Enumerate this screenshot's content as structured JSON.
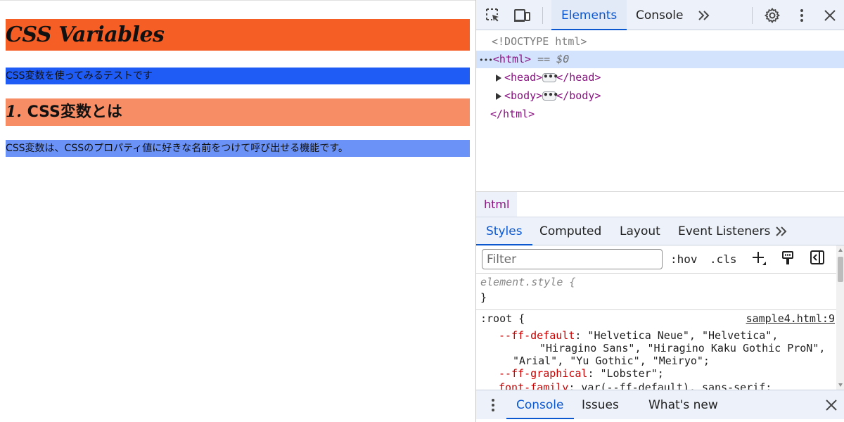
{
  "page": {
    "h1": "CSS Variables",
    "p1": "CSS変数を使ってみるテストです",
    "h2_number": "1.",
    "h2_text": " CSS変数とは",
    "p2": "CSS変数は、CSSのプロパティ値に好きな名前をつけて呼び出せる機能です。"
  },
  "devtools": {
    "tabs": [
      "Elements",
      "Console"
    ],
    "active_tab": "Elements",
    "more_tabs": "»",
    "dom": {
      "doctype": "<!DOCTYPE html>",
      "html_open": "<html>",
      "selected_marker": "== $0",
      "selected_prefix": "•••",
      "head_open": "<head>",
      "head_close": "</head>",
      "body_open": "<body>",
      "body_close": "</body>",
      "html_close": "</html>",
      "ellipsis": "•••"
    },
    "breadcrumb": "html",
    "sub_tabs": [
      "Styles",
      "Computed",
      "Layout",
      "Event Listeners"
    ],
    "active_sub_tab": "Styles",
    "sub_more": "»",
    "filter": {
      "placeholder": "Filter",
      "value": ""
    },
    "filter_buttons": {
      "hov": ":hov",
      "cls": ".cls"
    },
    "styles": {
      "element_style_open": "element.style {",
      "element_style_close": "}",
      "root_selector": ":root {",
      "root_source": "sample4.html:9",
      "ff_default_prop": "--ff-default",
      "ff_default_val_1": ": \"Helvetica Neue\", \"Helvetica\",",
      "ff_default_val_2": "\"Hiragino Sans\", \"Hiragino Kaku Gothic ProN\",",
      "ff_default_val_3": "\"Arial\", \"Yu Gothic\", \"Meiryo\";",
      "ff_graphical_prop": "--ff-graphical",
      "ff_graphical_val": ": \"Lobster\";",
      "font_family_prop": "font-family",
      "font_family_val": ": var(--ff-default), sans-serif;"
    },
    "drawer_tabs": [
      "Console",
      "Issues",
      "What's new"
    ],
    "active_drawer_tab": "Console"
  }
}
